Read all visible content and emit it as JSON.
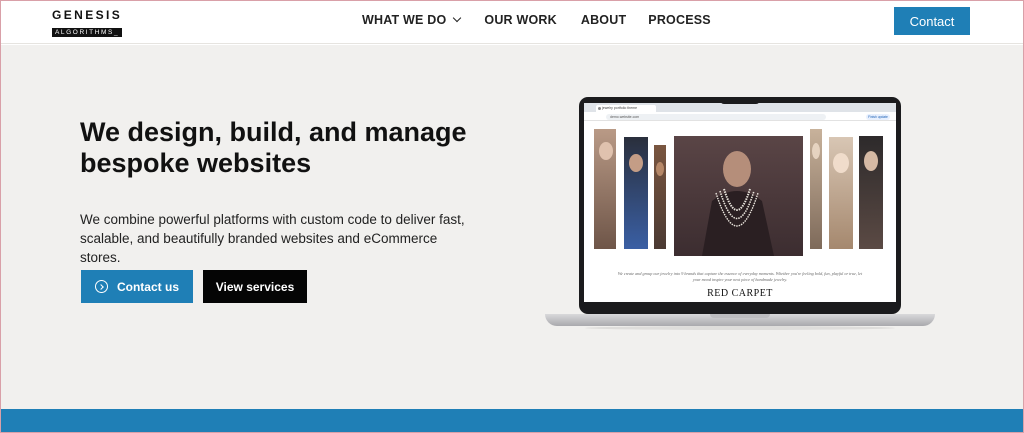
{
  "brand": {
    "name_top": "GENESIS",
    "name_bottom": "ALGORITHMS_"
  },
  "nav": {
    "items": [
      {
        "label": "WHAT WE DO"
      },
      {
        "label": "OUR WORK"
      },
      {
        "label": "ABOUT"
      },
      {
        "label": "PROCESS"
      }
    ],
    "contact_label": "Contact"
  },
  "hero": {
    "title": "We design, build, and manage bespoke websites",
    "subtitle": "We combine powerful platforms with custom code to deliver fast, scalable, and beautifully branded websites and eCommerce stores.",
    "primary_cta": "Contact us",
    "secondary_cta": "View services"
  },
  "laptop_screen": {
    "tab_title": "jewelry portfolio theme",
    "url": "demo.website.com",
    "browser_button": "Finish update",
    "caption": "We create and group our jewelry into 9 brands that capture the essence of everyday moments. Whether you're feeling bold, fun, playful or true, let your mood inspire your next piece of handmade jewelry.",
    "brand": "RED CARPET"
  },
  "colors": {
    "accent": "#1f7fb6",
    "hero_bg": "#f1f0ee",
    "dark_button": "#050505"
  },
  "icons": {
    "dropdown": "chevron-down-icon",
    "cta": "circle-arrow-right-icon"
  }
}
